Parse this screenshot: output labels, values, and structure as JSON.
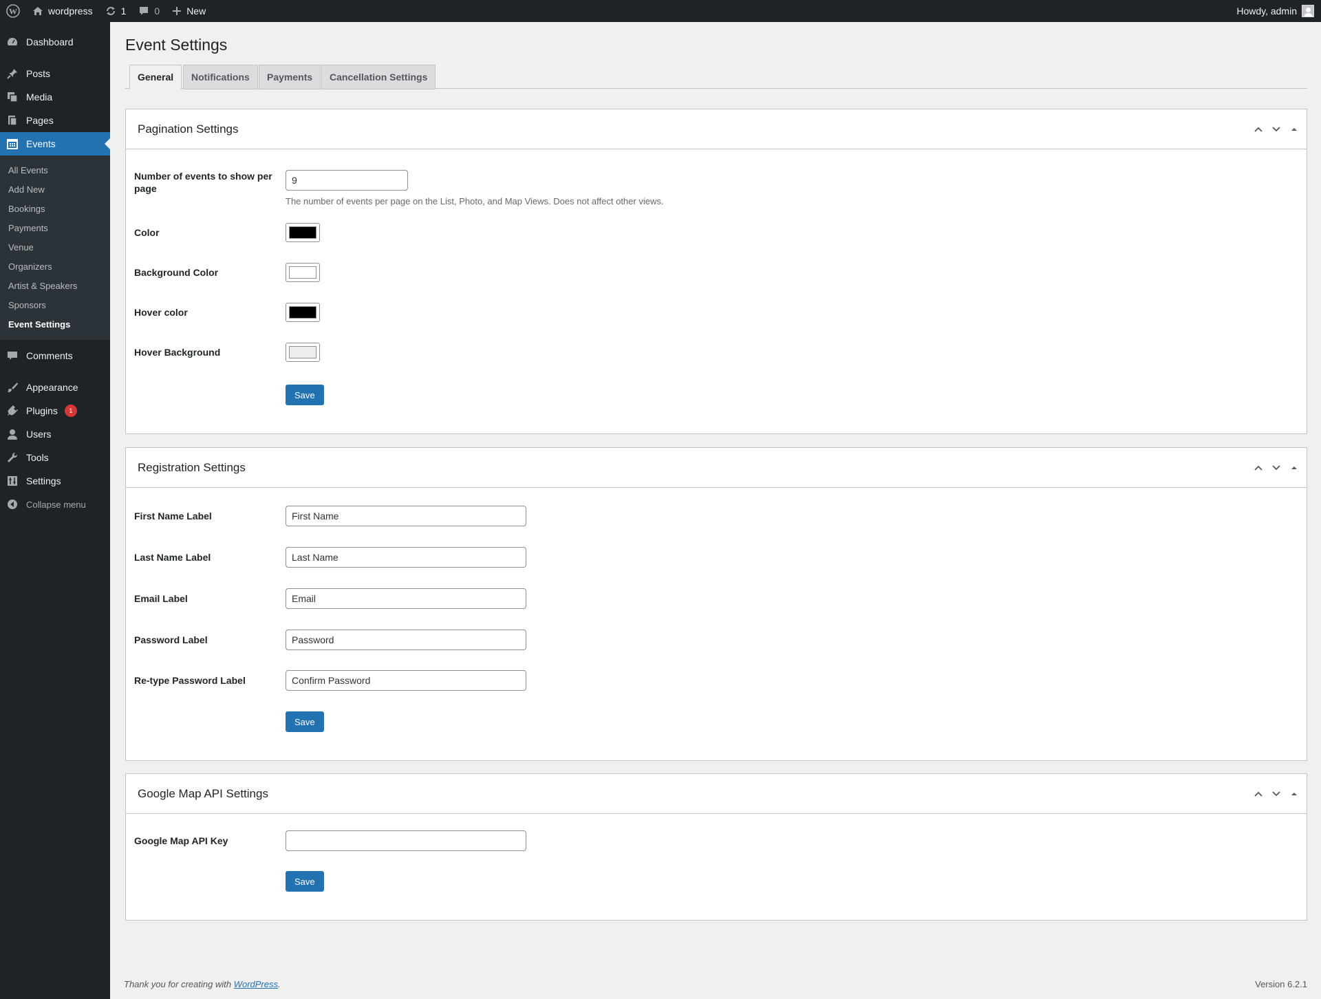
{
  "adminbar": {
    "site_name": "wordpress",
    "updates_count": "1",
    "comments_count": "0",
    "new_label": "New",
    "howdy": "Howdy, admin"
  },
  "sidebar": {
    "dashboard": "Dashboard",
    "posts": "Posts",
    "media": "Media",
    "pages": "Pages",
    "events": "Events",
    "submenu": [
      "All Events",
      "Add New",
      "Bookings",
      "Payments",
      "Venue",
      "Organizers",
      "Artist & Speakers",
      "Sponsors",
      "Event Settings"
    ],
    "comments": "Comments",
    "appearance": "Appearance",
    "plugins": "Plugins",
    "plugins_badge": "1",
    "users": "Users",
    "tools": "Tools",
    "settings": "Settings",
    "collapse": "Collapse menu"
  },
  "page": {
    "title": "Event Settings",
    "tabs": [
      "General",
      "Notifications",
      "Payments",
      "Cancellation Settings"
    ]
  },
  "pagination": {
    "title": "Pagination Settings",
    "events_per_page_label": "Number of events to show per page",
    "events_per_page_value": "9",
    "events_per_page_desc": "The number of events per page on the List, Photo, and Map Views. Does not affect other views.",
    "color_label": "Color",
    "color_value": "#000000",
    "bg_color_label": "Background Color",
    "bg_color_value": "#ffffff",
    "hover_color_label": "Hover color",
    "hover_color_value": "#000000",
    "hover_bg_label": "Hover Background",
    "hover_bg_value": "#eeeeee",
    "save": "Save"
  },
  "registration": {
    "title": "Registration Settings",
    "first_name_label": "First Name Label",
    "first_name_value": "First Name",
    "last_name_label": "Last Name Label",
    "last_name_value": "Last Name",
    "email_label": "Email Label",
    "email_value": "Email",
    "password_label": "Password Label",
    "password_value": "Password",
    "retype_label": "Re-type Password Label",
    "retype_value": "Confirm Password",
    "save": "Save"
  },
  "googlemap": {
    "title": "Google Map API Settings",
    "api_key_label": "Google Map API Key",
    "api_key_value": "",
    "save": "Save"
  },
  "footer": {
    "thanks_prefix": "Thank you for creating with",
    "wordpress_link": "WordPress",
    "thanks_suffix": ".",
    "version": "Version 6.2.1"
  },
  "colors": {
    "accent": "#2271b1",
    "adminbar_bg": "#1d2327",
    "badge": "#d63638"
  }
}
